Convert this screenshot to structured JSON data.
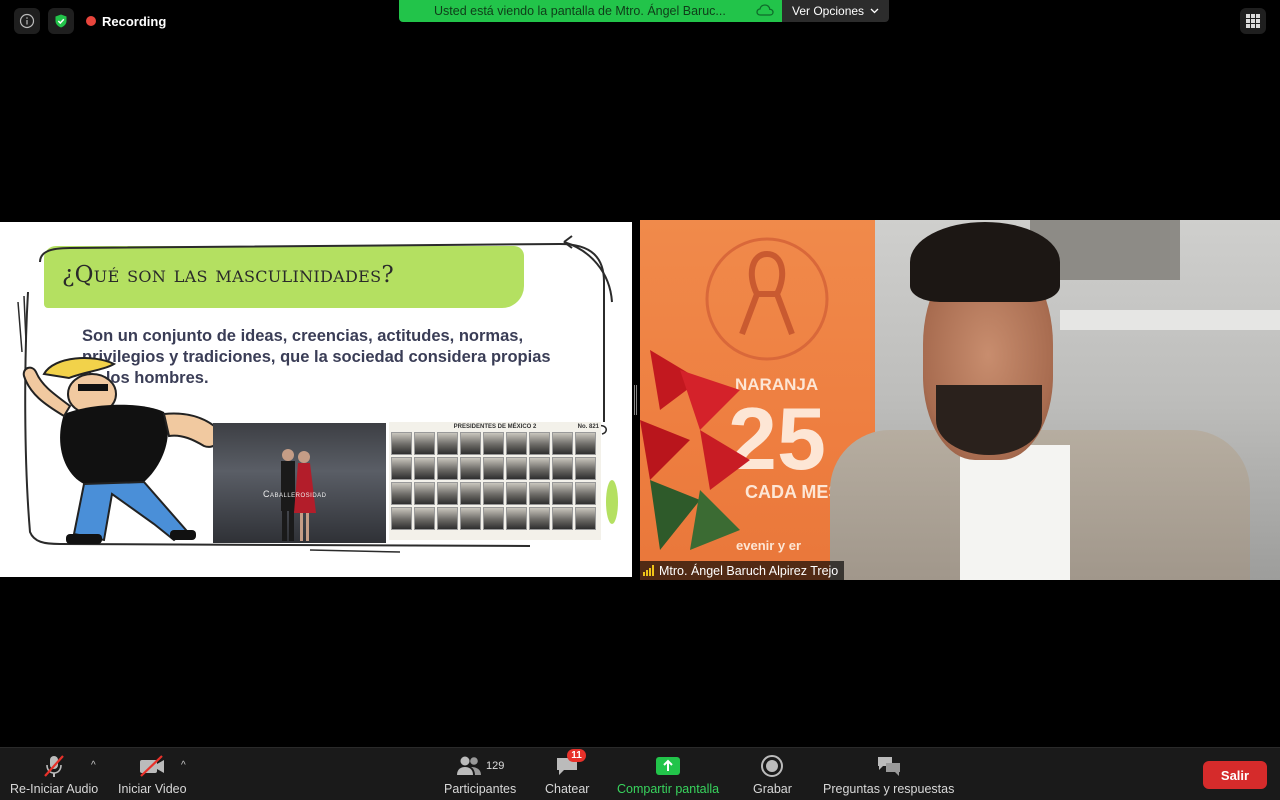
{
  "top": {
    "recording_label": "Recording",
    "share_banner": "Usted está viendo la pantalla de Mtro. Ángel Baruc...",
    "view_options": "Ver Opciones"
  },
  "slide": {
    "title": "¿Qué son las masculinidades?",
    "body": "Son un conjunto de ideas, creencias, actitudes, normas, privilegios y tradiciones, que la sociedad considera propias de los hombres.",
    "photo_caption": "Caballerosidad",
    "presidents_title": "PRESIDENTES DE MÉXICO 2",
    "presidents_no": "No. 821"
  },
  "video": {
    "participant_name": "Mtro. Ángel Baruch Alpirez Trejo",
    "banner_line1": "NARANJA",
    "banner_big": "25",
    "banner_line2": "CADA MES",
    "banner_line3": "evenir y er"
  },
  "toolbar": {
    "audio_label": "Re-Iniciar Audio",
    "video_label": "Iniciar Video",
    "participants_label": "Participantes",
    "participants_count": "129",
    "chat_label": "Chatear",
    "chat_badge": "11",
    "share_label": "Compartir pantalla",
    "record_label": "Grabar",
    "qa_label": "Preguntas y respuestas",
    "leave_label": "Salir"
  },
  "colors": {
    "share_green": "#22c44a",
    "slide_green": "#b4e061",
    "leave_red": "#d52b2b",
    "record_red": "#e8453c",
    "banner_orange": "#ee7e40"
  }
}
